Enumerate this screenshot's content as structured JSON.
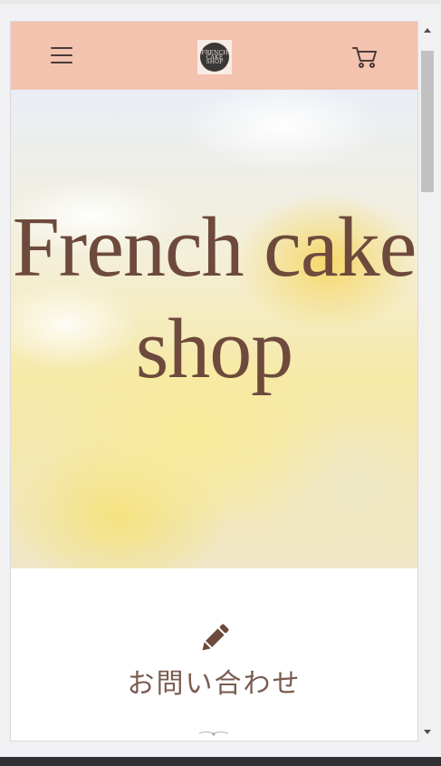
{
  "header": {
    "menu_icon": "hamburger-menu-icon",
    "logo_text": "FRENCH CAKE SHOP",
    "cart_icon": "cart-icon"
  },
  "hero": {
    "title": "French cake shop"
  },
  "contact": {
    "icon": "pencil-icon",
    "label": "お問い合わせ"
  },
  "colors": {
    "header_bg": "#f3c3af",
    "title_text": "#6e4a3c",
    "contact_text": "#7a5b50"
  }
}
